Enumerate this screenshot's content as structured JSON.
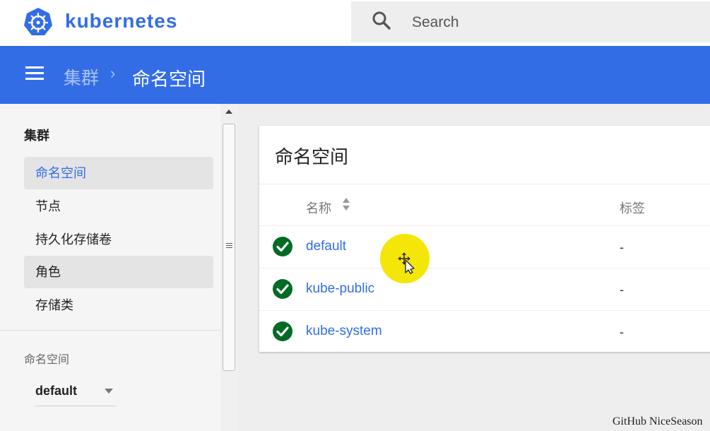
{
  "header": {
    "brand": "kubernetes",
    "logo_icon": "kubernetes-helm-icon",
    "search": {
      "placeholder": "Search",
      "icon": "search-icon"
    }
  },
  "breadcrumb": {
    "parent": "集群",
    "separator": "›",
    "current": "命名空间"
  },
  "sidebar": {
    "section_title": "集群",
    "items": [
      {
        "label": "命名空间",
        "state": "active"
      },
      {
        "label": "节点",
        "state": "normal"
      },
      {
        "label": "持久化存储卷",
        "state": "normal"
      },
      {
        "label": "角色",
        "state": "hover"
      },
      {
        "label": "存储类",
        "state": "normal"
      }
    ],
    "namespace_label": "命名空间",
    "namespace_value": "default"
  },
  "card": {
    "title": "命名空间",
    "columns": {
      "name": "名称",
      "labels": "标签"
    },
    "rows": [
      {
        "name": "default",
        "labels": "-",
        "status": "ok"
      },
      {
        "name": "kube-public",
        "labels": "-",
        "status": "ok"
      },
      {
        "name": "kube-system",
        "labels": "-",
        "status": "ok"
      }
    ]
  },
  "watermark": "GitHub NiceSeason",
  "colors": {
    "brand_blue": "#326de6",
    "status_green": "#006b24",
    "cursor_highlight": "#f5e60a"
  }
}
